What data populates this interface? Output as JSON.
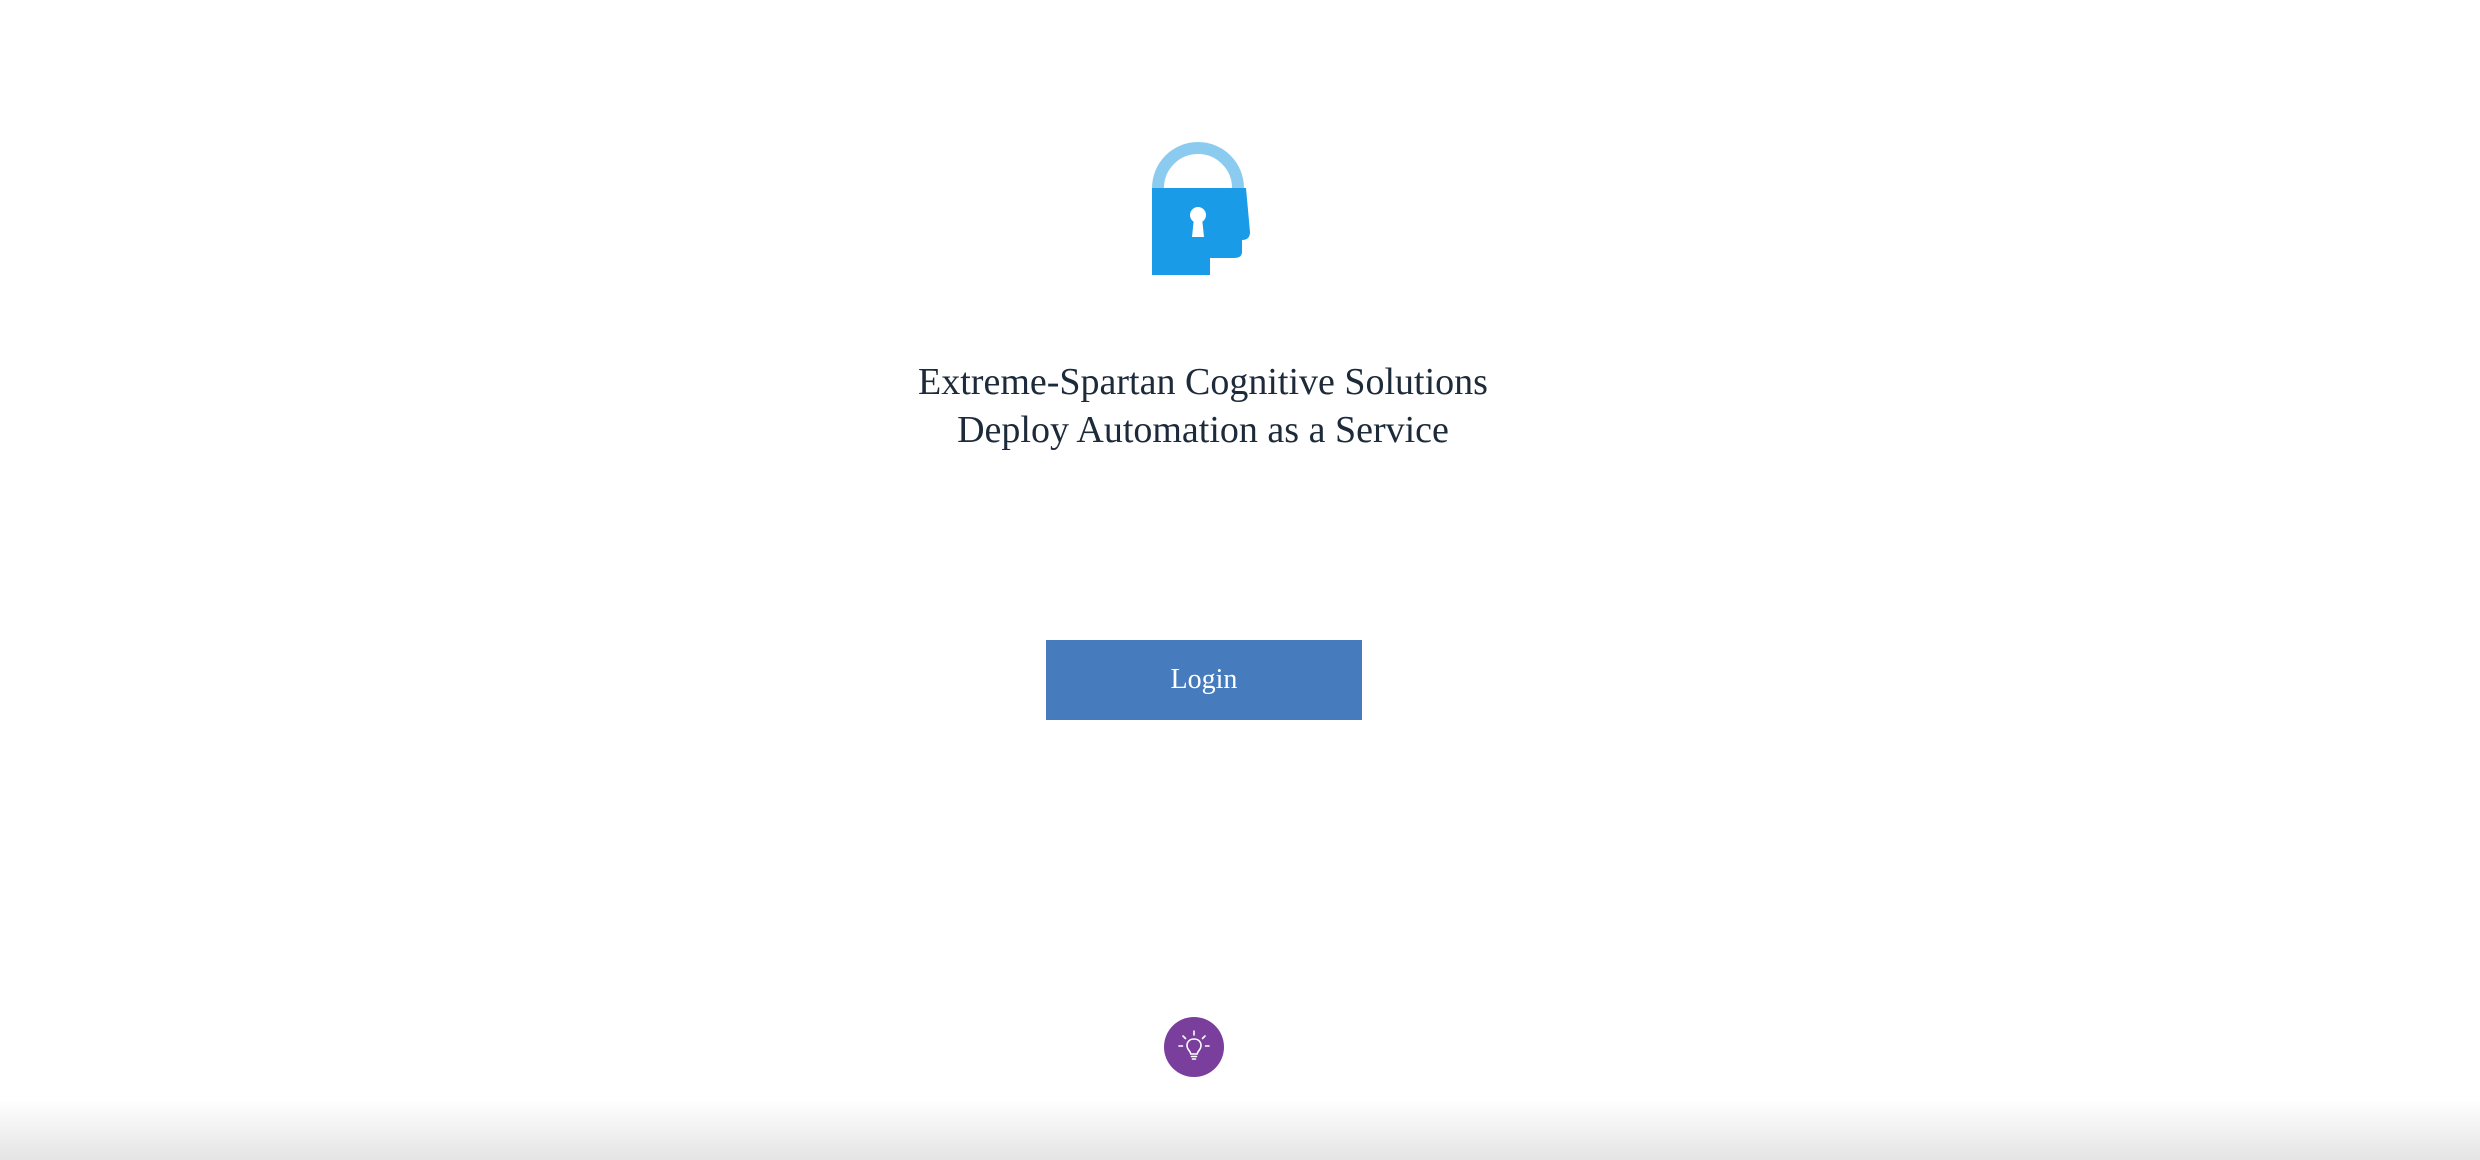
{
  "branding": {
    "logo_icon": "padlock-head-icon",
    "company_name": "Extreme-Spartan Cognitive Solutions",
    "tagline": "Deploy Automation as a Service",
    "colors": {
      "logo_primary": "#1a9be8",
      "logo_shackle": "#8ccbf0",
      "text": "#1d2a3a"
    }
  },
  "login": {
    "label": "Login",
    "color": "#467bbd"
  },
  "tip": {
    "icon": "lightbulb-icon",
    "color": "#7a3f9c"
  }
}
